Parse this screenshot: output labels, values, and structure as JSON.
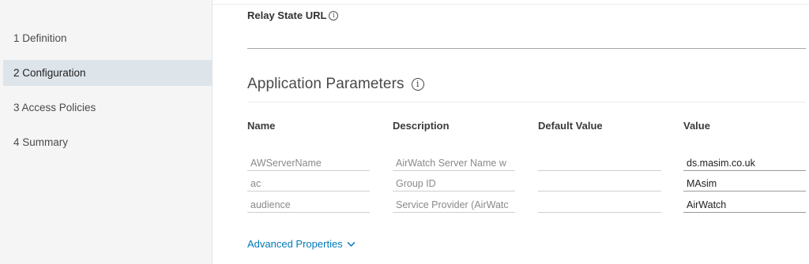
{
  "sidebar": {
    "steps": [
      {
        "label": "1 Definition"
      },
      {
        "label": "2 Configuration"
      },
      {
        "label": "3 Access Policies"
      },
      {
        "label": "4 Summary"
      }
    ]
  },
  "relay": {
    "label": "Relay State URL",
    "info_icon": "info-icon",
    "value": ""
  },
  "params": {
    "title": "Application Parameters",
    "info_icon": "info-icon",
    "headers": {
      "name": "Name",
      "description": "Description",
      "default_value": "Default Value",
      "value": "Value"
    },
    "rows": [
      {
        "name": "AWServerName",
        "description": "AirWatch Server Name w",
        "default_value": "",
        "value": "ds.masim.co.uk"
      },
      {
        "name": "ac",
        "description": "Group ID",
        "default_value": "",
        "value": "MAsim"
      },
      {
        "name": "audience",
        "description": "Service Provider (AirWatc",
        "default_value": "",
        "value": "AirWatch"
      }
    ]
  },
  "advanced": {
    "label": "Advanced Properties",
    "icon": "chevron-down-icon"
  },
  "colors": {
    "link": "#0079b8",
    "active_step_bg": "#dde4ea",
    "sidebar_bg": "#f5f5f5"
  }
}
